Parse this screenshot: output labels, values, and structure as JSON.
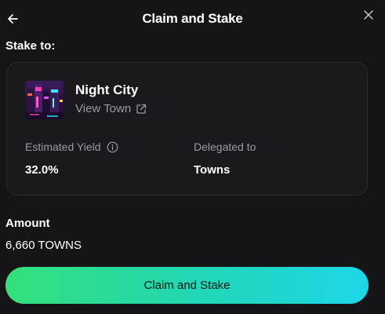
{
  "header": {
    "title": "Claim and Stake",
    "back_icon": "arrow-left-icon",
    "close_icon": "close-icon"
  },
  "stake_to": {
    "label": "Stake to:",
    "town": {
      "name": "Night City",
      "link_label": "View Town",
      "link_icon": "external-link-icon",
      "image": "neon night city thumbnail"
    },
    "estimated_yield": {
      "label": "Estimated Yield",
      "value": "32.0%",
      "info_icon": "info-icon"
    },
    "delegated_to": {
      "label": "Delegated to",
      "value": "Towns"
    }
  },
  "amount": {
    "label": "Amount",
    "value": "6,660 TOWNS"
  },
  "cta": {
    "label": "Claim and Stake"
  },
  "colors": {
    "background": "#151417",
    "card": "#1a191d",
    "muted_text": "#9c9aa3",
    "gradient_start": "#34e07a",
    "gradient_end": "#1dd6e8"
  }
}
